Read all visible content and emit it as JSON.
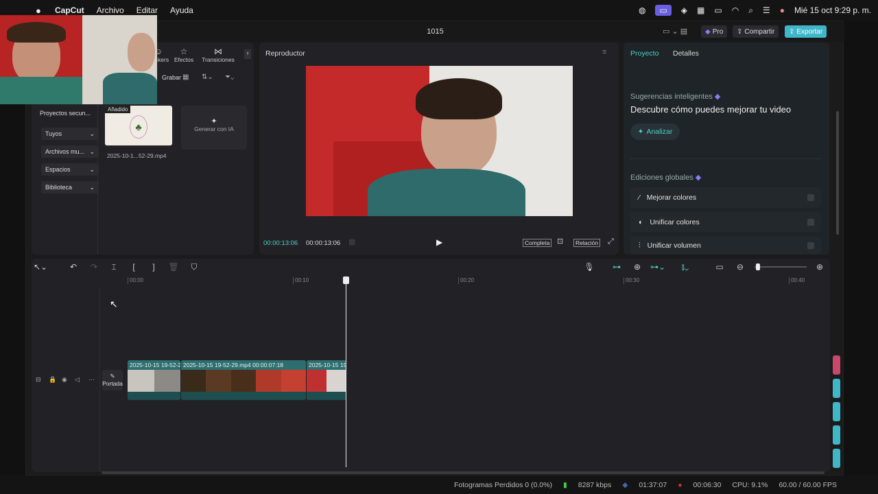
{
  "menubar": {
    "app": "CapCut",
    "items": [
      "Archivo",
      "Editar",
      "Ayuda"
    ],
    "datetime": "Mié 15 oct  9:29 p. m."
  },
  "titlebar": {
    "title": "1015",
    "pro_label": "Pro",
    "share_label": "Compartir",
    "export_label": "Exportar"
  },
  "media_tabs": [
    "Stickers",
    "Efectos",
    "Transiciones"
  ],
  "media_toolbar": {
    "record_label": "Grabar"
  },
  "sidebar": {
    "items": [
      "Proyectos secun...",
      "Tuyos",
      "Archivos mu...",
      "Espacios",
      "Biblioteca"
    ]
  },
  "media": {
    "added_badge": "Añadido",
    "file_name": "2025-10-1...52-29.mp4",
    "generate_label": "Generar con IA"
  },
  "player": {
    "title": "Reproductor",
    "current_time": "00:00:13:06",
    "total_time": "00:00:13:06",
    "full_label": "Completa",
    "ratio_label": "Relación"
  },
  "right_panel": {
    "tabs": [
      "Proyecto",
      "Detalles"
    ],
    "smart_title": "Sugerencias inteligentes",
    "smart_heading": "Descubre cómo puedes mejorar tu video",
    "analyze_label": "Analizar",
    "global_title": "Ediciones globales",
    "global_items": [
      "Mejorar colores",
      "Unificar colores",
      "Unificar volumen"
    ]
  },
  "timeline": {
    "ruler": [
      "00:00",
      "00:10",
      "00:20",
      "00:30",
      "00:40"
    ],
    "cover_label": "Portada",
    "clips": [
      {
        "label": "2025-10-15 19-52-2"
      },
      {
        "label": "2025-10-15 19-52-29.mp4   00:00:07:18"
      },
      {
        "label": "2025-10-15 19"
      }
    ]
  },
  "status": {
    "dropped": "Fotogramas Perdidos 0 (0.0%)",
    "bitrate": "8287 kbps",
    "elapsed": "01:37:07",
    "rec_time": "00:06:30",
    "cpu": "CPU: 9.1%",
    "fps": "60.00 / 60.00 FPS"
  },
  "colors": {
    "accent": "#4fd1c5",
    "export": "#3fb7c9",
    "clip": "#2e6e6f",
    "pro": "#8b7cf6"
  }
}
